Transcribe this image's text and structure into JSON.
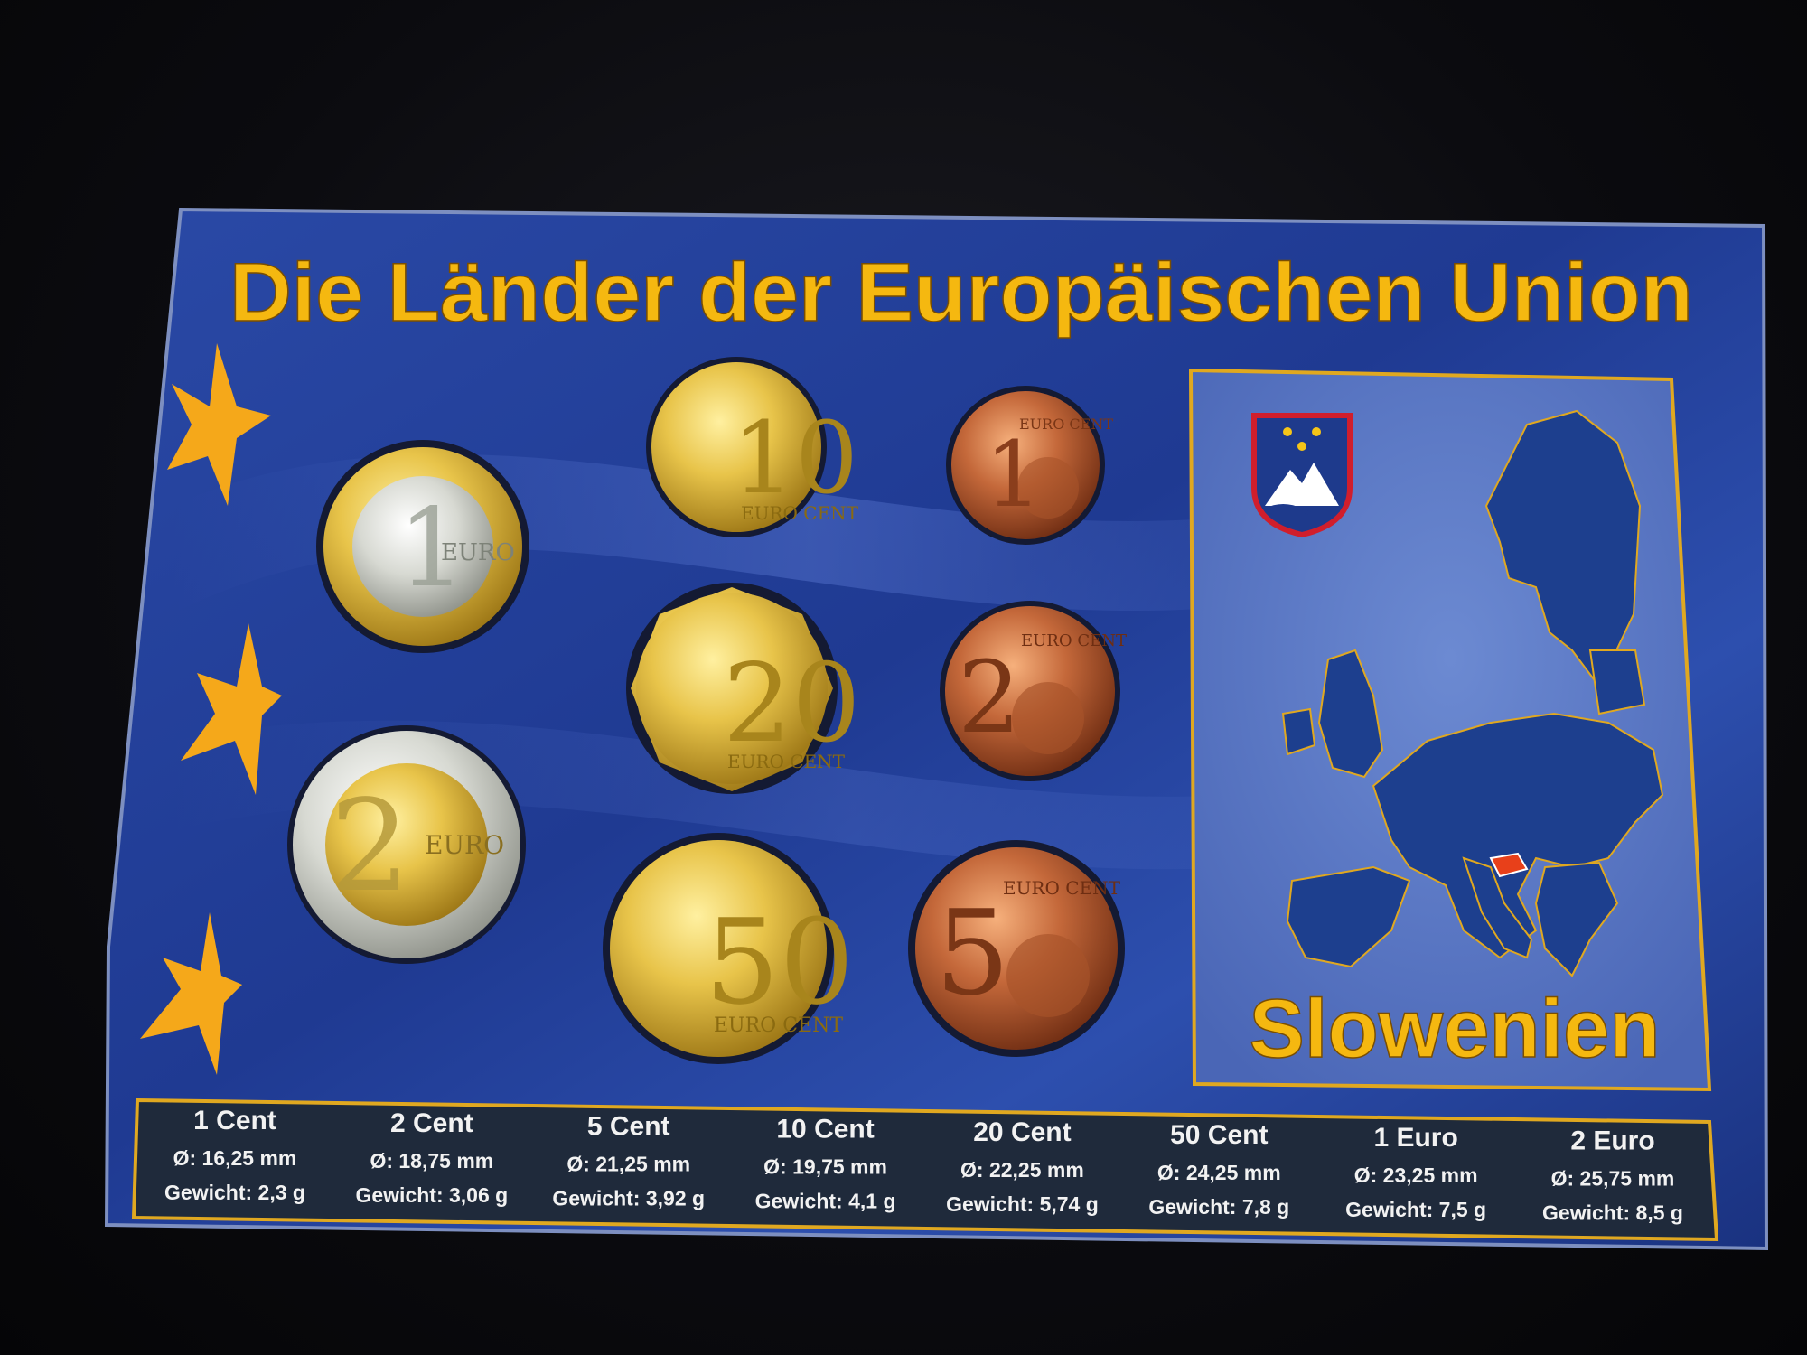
{
  "title": "Die Länder der Europäischen Union",
  "country": "Slowenien",
  "colors": {
    "card_blue": "#223c8f",
    "title_yellow": "#f5b810",
    "spec_box": "#1e2a3a",
    "gold_border": "#e0a820",
    "map_country": "#1d3f8e",
    "slovenia": "#e8401a"
  },
  "coins": [
    {
      "label": "1",
      "unit": "EURO",
      "metal": "bimetal-gold-center"
    },
    {
      "label": "2",
      "unit": "EURO",
      "metal": "bimetal-silver-center"
    },
    {
      "label": "10",
      "unit": "EURO CENT",
      "metal": "nordic-gold"
    },
    {
      "label": "20",
      "unit": "EURO CENT",
      "metal": "nordic-gold"
    },
    {
      "label": "50",
      "unit": "EURO CENT",
      "metal": "nordic-gold"
    },
    {
      "label": "1",
      "unit": "EURO CENT",
      "metal": "copper"
    },
    {
      "label": "2",
      "unit": "EURO CENT",
      "metal": "copper"
    },
    {
      "label": "5",
      "unit": "EURO CENT",
      "metal": "copper"
    }
  ],
  "specs": [
    {
      "name": "1 Cent",
      "diameter": "Ø: 16,25 mm",
      "weight": "Gewicht: 2,3 g"
    },
    {
      "name": "2 Cent",
      "diameter": "Ø: 18,75 mm",
      "weight": "Gewicht: 3,06 g"
    },
    {
      "name": "5 Cent",
      "diameter": "Ø: 21,25 mm",
      "weight": "Gewicht: 3,92 g"
    },
    {
      "name": "10 Cent",
      "diameter": "Ø: 19,75 mm",
      "weight": "Gewicht: 4,1 g"
    },
    {
      "name": "20 Cent",
      "diameter": "Ø: 22,25 mm",
      "weight": "Gewicht: 5,74 g"
    },
    {
      "name": "50 Cent",
      "diameter": "Ø: 24,25 mm",
      "weight": "Gewicht: 7,8 g"
    },
    {
      "name": "1 Euro",
      "diameter": "Ø: 23,25 mm",
      "weight": "Gewicht: 7,5 g"
    },
    {
      "name": "2 Euro",
      "diameter": "Ø: 25,75 mm",
      "weight": "Gewicht: 8,5 g"
    }
  ]
}
